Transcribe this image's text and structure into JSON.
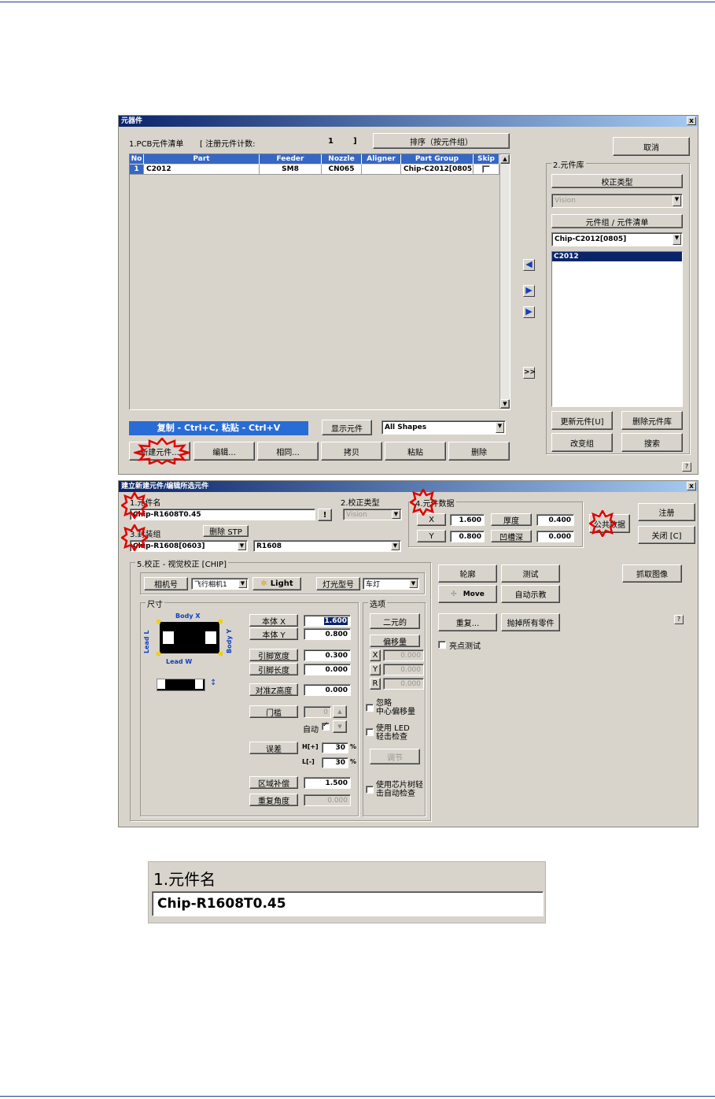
{
  "win1": {
    "title": "元器件",
    "close": "x",
    "pcb_list_label": "1.PCB元件清单",
    "reg_count_label": "[ 注册元件计数:",
    "reg_count_value": "1",
    "reg_count_close": "]",
    "sort_button": "排序（按元件组）",
    "cancel_button": "取消",
    "columns": [
      "No",
      "Part",
      "Feeder",
      "Nozzle",
      "Aligner",
      "Part Group",
      "Skip"
    ],
    "rows": [
      {
        "no": "1",
        "part": "C2012",
        "feeder": "SM8",
        "nozzle": "CN065",
        "aligner": "",
        "part_group": "Chip-C2012[0805]"
      }
    ],
    "copy_hint": "复制 - Ctrl+C, 粘贴 - Ctrl+V",
    "show_parts_label": "显示元件",
    "show_parts_value": "All Shapes",
    "buttons": {
      "new": "新建元件...",
      "edit": "编辑...",
      "same": "相同...",
      "copy": "拷贝",
      "paste": "粘贴",
      "delete": "删除"
    },
    "library": {
      "group_title": "2.元件库",
      "correction_type_button": "校正类型",
      "correction_type_value": "Vision",
      "group_list_button": "元件组 / 元件清单",
      "group_value": "Chip-C2012[0805]",
      "items": [
        "C2012"
      ],
      "update_button": "更新元件[U]",
      "delete_lib_button": "删除元件库",
      "change_group_button": "改变组",
      "search_button": "搜索"
    },
    "arrows": [
      "◀",
      "▶",
      "▶",
      ">>"
    ],
    "help": "?"
  },
  "win2": {
    "title": "建立新建元件/编辑所选元件",
    "close": "x",
    "part_name_label": "1.元件名",
    "part_name_value": "Chip-R1608T0.45",
    "bang_button": "!",
    "correction_label": "2.校正类型",
    "correction_value": "Vision",
    "part_data_label": "4.元件数据",
    "x_label": "X",
    "x_value": "1.600",
    "y_label": "Y",
    "y_value": "0.800",
    "thickness_label": "厚度",
    "thickness_value": "0.400",
    "recess_label": "凹槽深",
    "recess_value": "0.000",
    "common_data_button": "公共数据",
    "register_button": "注册",
    "close_button": "关闭 [C]",
    "package_label": "3.封装组",
    "delete_stp_button": "删除 STP",
    "package_value": "Chip-R1608[0603]",
    "package_sub_value": "R1608",
    "vision_group_title": "5.校正 - 视觉校正 [CHIP]",
    "camera_label": "相机号",
    "camera_value": "飞行相机1",
    "light_button": "Light",
    "lamp_label": "灯光型号",
    "lamp_value": "车灯",
    "size_group": "尺寸",
    "diagram_labels": {
      "body_x": "Body X",
      "body_y": "Body Y",
      "lead_l": "Lead L",
      "lead_w": "Lead W"
    },
    "fields": [
      {
        "label": "本体 X",
        "value": "1.600"
      },
      {
        "label": "本体 Y",
        "value": "0.800"
      },
      {
        "label": "引脚宽度",
        "value": "0.300"
      },
      {
        "label": "引脚长度",
        "value": "0.000"
      },
      {
        "label": "对准Z高度",
        "value": "0.000"
      }
    ],
    "threshold_label": "门槛",
    "threshold_value": "0",
    "auto_label": "自动",
    "error_label": "误差",
    "h_label": "H[+]",
    "h_value": "30",
    "l_label": "L[-]",
    "l_value": "30",
    "percent": "%",
    "area_comp_label": "区域补偿",
    "area_comp_value": "1.500",
    "repeat_angle_label": "重复角度",
    "repeat_angle_value": "0.000",
    "options_group": "选项",
    "two_element_button": "二元的",
    "offset_button": "偏移量",
    "offset_x_label": "X",
    "offset_x_value": "0.000",
    "offset_y_label": "Y",
    "offset_y_value": "0.000",
    "offset_r_label": "R",
    "offset_r_value": "0.000",
    "ignore_center_label": "忽略\n中心偏移量",
    "use_led_label": "使用 LED\n轻击检查",
    "adjust_button": "调节",
    "use_chip_label": "使用芯片树轻\n击自动检查",
    "outline_button": "轮廓",
    "test_button": "测试",
    "grab_button": "抓取图像",
    "move_button": "Move",
    "auto_teach_button": "自动示教",
    "repeat_button": "重复...",
    "discard_button": "抛掉所有零件",
    "bright_test_label": "亮点测试",
    "help": "?"
  },
  "zoom": {
    "label": "1.元件名",
    "value": "Chip-R1608T0.45"
  }
}
